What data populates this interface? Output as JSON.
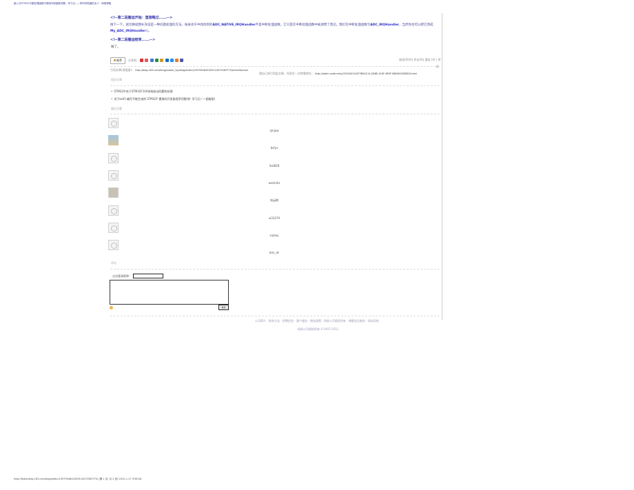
{
  "header": {
    "title": "嵌入式STM32中断处理函数中调用外部函数问题 - 学习记——有时你知道的太少 - 网易博客"
  },
  "article": {
    "code_start": "<!--第二段搬运开始：直接略过......-->",
    "paragraph_prefix": "搜下一下。就切换就我补充说是一种问题处理的方法，按关闭于中找找到的",
    "paragraph_bold1": "ADC_NATIVE_IRQHandler",
    "paragraph_mid": "不是中断处理函数，它只是在中断处理函数中被调用了而已。我们在中断处理函数写",
    "paragraph_bold2": "ADC_IRQHandler",
    "paragraph_mid2": "，当然你也可以把它改成",
    "paragraph_bold3": "My_ADC_IRQHandler",
    "paragraph_end": "()。",
    "code_end": "<!--第二段搬运结束......-->",
    "done": "做了。"
  },
  "share": {
    "button_label": "推荐",
    "label": "分享到：",
    "icons": [
      "weibo-icon",
      "qzone-icon",
      "renren-icon",
      "douban-icon",
      "kaixin-icon",
      "qq-icon",
      "tencent-icon",
      "sohu-icon",
      "more-icon"
    ],
    "icon_colors": [
      "#d33",
      "#e55",
      "#3a7bd5",
      "#2c8f3c",
      "#c93",
      "#1b6fb5",
      "#1e90ff",
      "#e67e22",
      "#55a"
    ],
    "stats": "阅读(604)| 评论(0)| 喜欢 (0) | 举",
    "report": "报"
  },
  "trackback": {
    "label": "引用文章(用链接)：",
    "url": "http://blog.163.com/fengyixiaoli_rsp/blog/static/1097594842009110072563775/enterDomain",
    "source_label": "我自己来引用此文章，所发生一次转载地址：",
    "source_url": "http://static.code.net/y/20100410/4F3B5AC14-DE6E-419F-8E9F-BDD9A52BDD4.html"
  },
  "related": {
    "title": "相关文章",
    "items": [
      "STM32中关于STM32F10X系统启动问题的处理",
      "关于keil5 编写不能生成的 STM32F 模拟的开发板程序问题(转- 学习记——超级版)"
    ]
  },
  "visitors": {
    "title": "最近访客",
    "users": [
      "ljmjaw",
      "bsfyx",
      "ikal828",
      "wedrzhz",
      "电云鹤",
      "w33279",
      "xiyboy",
      "bon_ds"
    ]
  },
  "comments": {
    "title": "评论",
    "name_label": "点击登录昵称：",
    "submit_label": "发表"
  },
  "footer": {
    "copyright": "公司简介 - 联系方法 - 招聘信息 - 客户服务 - 隐私政策 - 网易公司版权所有 - 博客会员服务 - 网站导航",
    "copyright2": "网易公司版权所有 ©1997-2011",
    "url": "http://fwkai.blog.163.com/blog/static/1097594842009110072563775/ [第 1 页, 共 2 页] 2012-1-17 9:58:28"
  }
}
